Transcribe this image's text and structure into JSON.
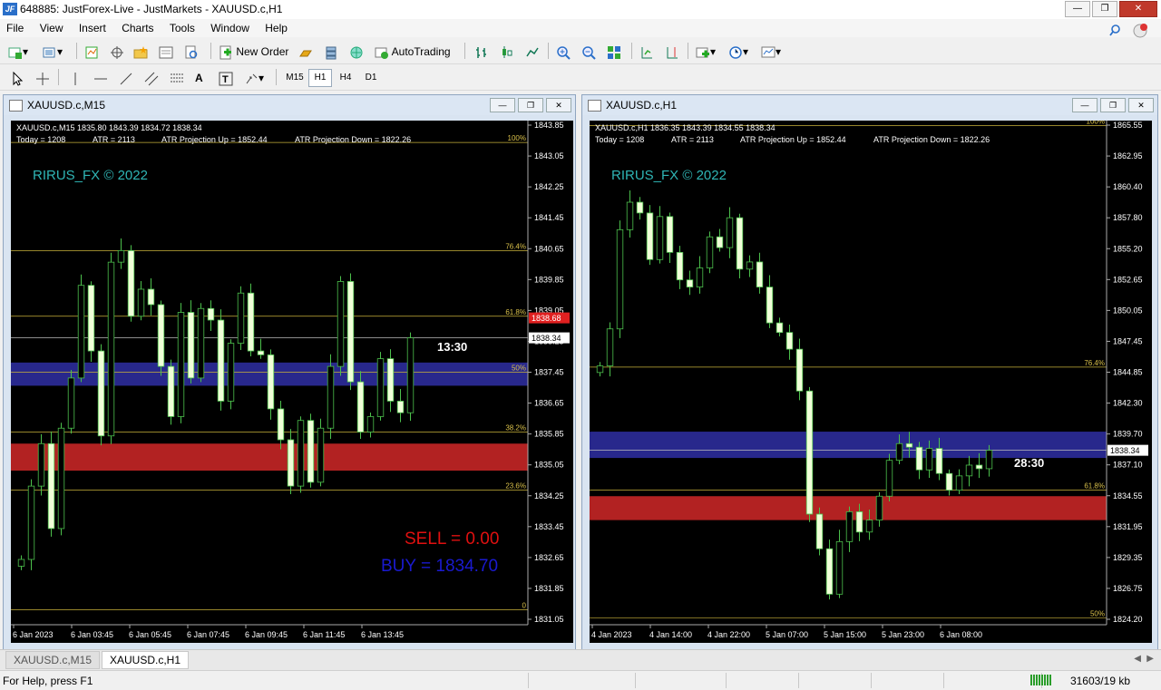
{
  "app": {
    "title": "648885: JustForex-Live - JustMarkets - XAUUSD.c,H1",
    "logo": "JF"
  },
  "menu": [
    "File",
    "View",
    "Insert",
    "Charts",
    "Tools",
    "Window",
    "Help"
  ],
  "toolbar": {
    "new_order": "New Order",
    "autotrading": "AutoTrading"
  },
  "timeframes": [
    "M15",
    "H1",
    "H4",
    "D1"
  ],
  "active_timeframe": "H1",
  "watermark": "RIRUS_FX © 2022",
  "left_chart": {
    "window_title": "XAUUSD.c,M15",
    "header": "XAUUSD.c,M15  1835.80 1843.39 1834.72 1838.34",
    "stats": [
      "Today = 1208",
      "ATR = 2113",
      "ATR Projection Up = 1852.44",
      "ATR Projection Down = 1822.26"
    ],
    "price_ticks": [
      "1843.85",
      "1843.05",
      "1842.25",
      "1841.45",
      "1840.65",
      "1839.85",
      "1839.05",
      "1838.25",
      "1837.45",
      "1836.65",
      "1835.85",
      "1835.05",
      "1834.25",
      "1833.45",
      "1832.65",
      "1831.85",
      "1831.05"
    ],
    "current_price": "1838.34",
    "red_price": "1838.68",
    "fib_labels": [
      "100%",
      "76.4%",
      "61.8%",
      "50%",
      "38.2%",
      "23.6%",
      "0"
    ],
    "timer": "13:30",
    "sell_text": "SELL = 0.00",
    "buy_text": "BUY = 1834.70",
    "time_labels": [
      "6 Jan 2023",
      "6 Jan 03:45",
      "6 Jan 05:45",
      "6 Jan 07:45",
      "6 Jan 09:45",
      "6 Jan 11:45",
      "6 Jan 13:45"
    ]
  },
  "right_chart": {
    "window_title": "XAUUSD.c,H1",
    "header": "XAUUSD.c,H1  1836.35 1843.39 1834.55 1838.34",
    "stats": [
      "Today = 1208",
      "ATR = 2113",
      "ATR Projection Up = 1852.44",
      "ATR Projection Down = 1822.26"
    ],
    "price_ticks": [
      "1865.55",
      "1862.95",
      "1860.40",
      "1857.80",
      "1855.20",
      "1852.65",
      "1850.05",
      "1847.45",
      "1844.85",
      "1842.30",
      "1839.70",
      "1837.10",
      "1834.55",
      "1831.95",
      "1829.35",
      "1826.75",
      "1824.20"
    ],
    "current_price": "1838.34",
    "fib_labels": [
      "100%",
      "76.4%",
      "61.8%",
      "50%"
    ],
    "timer": "28:30",
    "time_labels": [
      "4 Jan 2023",
      "4 Jan 14:00",
      "4 Jan 22:00",
      "5 Jan 07:00",
      "5 Jan 15:00",
      "5 Jan 23:00",
      "6 Jan 08:00"
    ]
  },
  "tabs": [
    "XAUUSD.c,M15",
    "XAUUSD.c,H1"
  ],
  "active_tab": "XAUUSD.c,H1",
  "status": {
    "help": "For Help, press F1",
    "traffic": "31603/19 kb"
  },
  "chart_data": [
    {
      "type": "candlestick",
      "title": "XAUUSD.c,M15",
      "ylim": [
        1831.05,
        1843.85
      ],
      "candles_close": [
        1832.6,
        1834.5,
        1835.6,
        1833.4,
        1836.0,
        1837.3,
        1839.7,
        1838.0,
        1835.8,
        1840.3,
        1840.6,
        1838.9,
        1839.6,
        1839.2,
        1837.6,
        1836.3,
        1839.0,
        1837.3,
        1839.1,
        1838.8,
        1836.7,
        1838.2,
        1839.5,
        1838.0,
        1837.9,
        1836.5,
        1835.7,
        1834.5,
        1836.2,
        1834.6,
        1836.0,
        1837.6,
        1839.8,
        1837.2,
        1835.9,
        1836.3,
        1837.8,
        1836.7,
        1836.4,
        1838.34
      ],
      "fib_levels": {
        "100%": 1843.4,
        "76.4%": 1840.6,
        "61.8%": 1838.9,
        "50%": 1837.45,
        "38.2%": 1835.9,
        "23.6%": 1834.4,
        "0": 1831.3
      },
      "zones": [
        {
          "from": 1837.1,
          "to": 1837.7,
          "color": "#28288c"
        },
        {
          "from": 1834.9,
          "to": 1835.6,
          "color": "#b22222"
        }
      ]
    },
    {
      "type": "candlestick",
      "title": "XAUUSD.c,H1",
      "ylim": [
        1824.2,
        1865.55
      ],
      "candles_close": [
        1845.4,
        1848.5,
        1856.8,
        1859.1,
        1858.2,
        1854.3,
        1857.9,
        1854.9,
        1852.6,
        1852.0,
        1853.6,
        1856.2,
        1855.3,
        1857.8,
        1853.5,
        1854.1,
        1852.0,
        1849.0,
        1848.2,
        1846.8,
        1843.3,
        1833.0,
        1830.1,
        1826.3,
        1830.7,
        1833.2,
        1831.5,
        1832.5,
        1834.5,
        1837.5,
        1838.9,
        1838.6,
        1836.7,
        1838.5,
        1836.4,
        1835.0,
        1836.2,
        1837.1,
        1836.8,
        1838.34
      ],
      "fib_levels": {
        "100%": 1865.5,
        "76.4%": 1845.3,
        "61.8%": 1835.0,
        "50%": 1824.3
      },
      "zones": [
        {
          "from": 1837.7,
          "to": 1839.9,
          "color": "#28288c"
        },
        {
          "from": 1832.5,
          "to": 1834.5,
          "color": "#b22222"
        }
      ]
    }
  ]
}
